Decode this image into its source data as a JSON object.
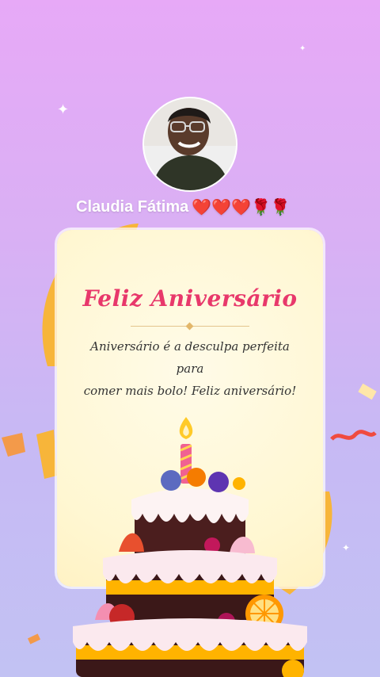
{
  "profile": {
    "name": "Claudia Fátima",
    "emojis": "❤️❤️❤️🌹🌹",
    "avatar_label": "profile-photo"
  },
  "card": {
    "title": "Feliz Aniversário",
    "message_line1": "Aniversário é a desculpa perfeita para",
    "message_line2": "comer mais bolo! Feliz aniversário!"
  },
  "colors": {
    "title": "#e8386b",
    "background_top": "#e7a9f7",
    "background_bottom": "#c2c2f3"
  }
}
